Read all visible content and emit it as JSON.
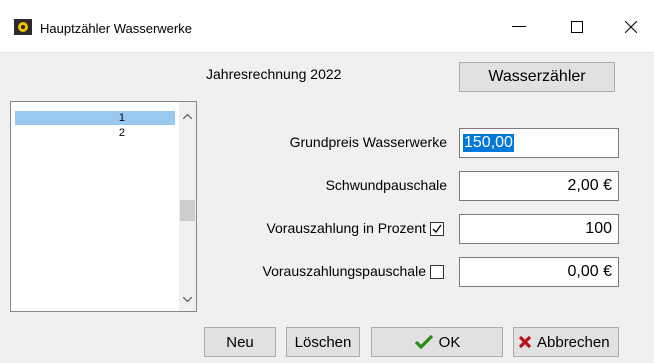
{
  "window": {
    "title": "Hauptzähler Wasserwerke",
    "minimize": "—",
    "maximize": "☐",
    "close": "✕"
  },
  "header": {
    "year_label": "Jahresrechnung 2022",
    "wasserzaehler_button": "Wasserzähler"
  },
  "list": {
    "items": [
      "1",
      "2"
    ],
    "selected_index": 0
  },
  "form": {
    "grundpreis": {
      "label": "Grundpreis Wasserwerke",
      "value": "150,00"
    },
    "schwund": {
      "label": "Schwundpauschale",
      "value": "2,00 €"
    },
    "vorauszahlung_prozent": {
      "label": "Vorauszahlung in Prozent",
      "value": "100",
      "checked": true
    },
    "vorauszahlung_pauschale": {
      "label": "Vorauszahlungspauschale",
      "value": "0,00 €",
      "checked": false
    }
  },
  "buttons": {
    "neu": "Neu",
    "loeschen": "Löschen",
    "ok": "OK",
    "abbrechen": "Abbrechen"
  },
  "colors": {
    "selection": "#0078d7",
    "list_selected": "#99c9ef",
    "ok_check": "#2a8a19",
    "cancel_x": "#b5121b"
  }
}
